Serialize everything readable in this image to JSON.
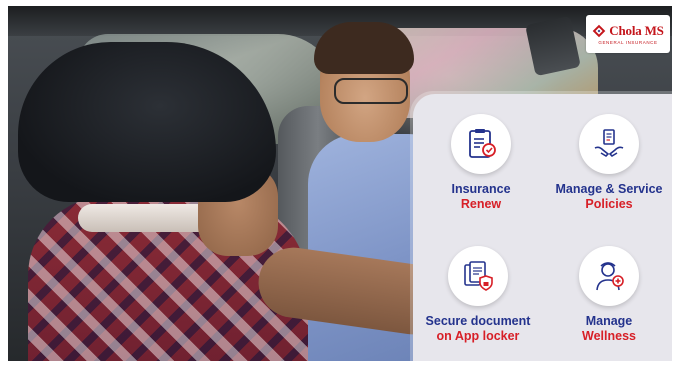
{
  "brand": {
    "name": "Chola",
    "suffix": "MS",
    "tagline": "GENERAL INSURANCE",
    "color": "#c4161c"
  },
  "features": [
    {
      "title": "Insurance",
      "subtitle": "Renew",
      "icon": "renew-document-icon"
    },
    {
      "title": "Manage & Service",
      "subtitle": "Policies",
      "icon": "hand-holding-policy-icon"
    },
    {
      "title": "Secure document",
      "subtitle": "on App locker",
      "icon": "document-lock-icon"
    },
    {
      "title": "Manage",
      "subtitle": "Wellness",
      "icon": "wellness-person-icon"
    }
  ],
  "colors": {
    "title": "#24338d",
    "subtitle": "#d71f27",
    "panel": "#e7e6ec"
  }
}
